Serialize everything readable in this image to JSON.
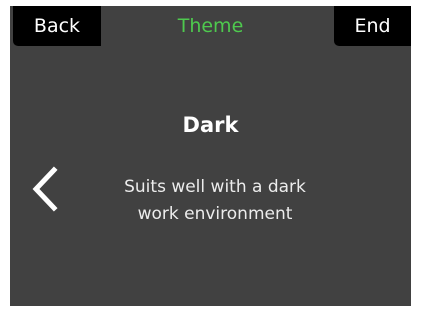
{
  "header": {
    "back_label": "Back",
    "title": "Theme",
    "end_label": "End"
  },
  "theme": {
    "name": "Dark",
    "description": "Suits well with a dark work environment"
  },
  "icons": {
    "previous": "chevron-left-icon"
  },
  "colors": {
    "background": "#414141",
    "button_bg": "#000000",
    "title_accent": "#4ec94e",
    "text": "#ffffff"
  }
}
